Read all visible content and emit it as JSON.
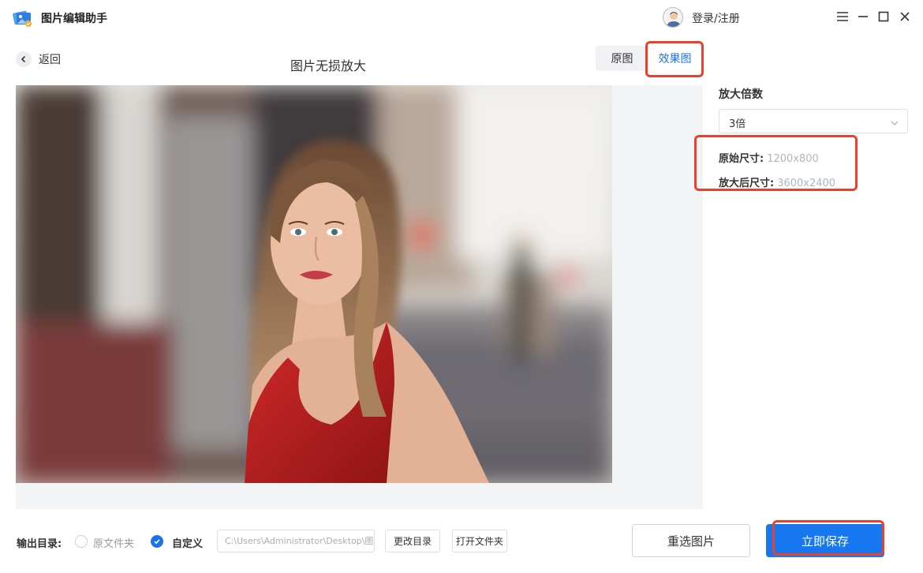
{
  "app": {
    "title": "图片编辑助手",
    "login_label": "登录/注册"
  },
  "header": {
    "back_label": "返回",
    "page_title": "图片无损放大",
    "view_tabs": {
      "original": "原图",
      "effect": "效果图"
    }
  },
  "settings": {
    "scale_label": "放大倍数",
    "scale_value": "3倍",
    "original_size_label": "原始尺寸:",
    "original_size_value": "1200x800",
    "enlarged_size_label": "放大后尺寸:",
    "enlarged_size_value": "3600x2400"
  },
  "output": {
    "label": "输出目录:",
    "option_source": "原文件夹",
    "option_custom": "自定义",
    "path_value": "C:\\Users\\Administrator\\Desktop\\图",
    "change_dir_label": "更改目录",
    "open_folder_label": "打开文件夹"
  },
  "actions": {
    "reselect_label": "重选图片",
    "save_label": "立即保存"
  },
  "colors": {
    "accent": "#1677f0",
    "highlight": "#e8412c",
    "placeholder": "#b0b4bc"
  }
}
